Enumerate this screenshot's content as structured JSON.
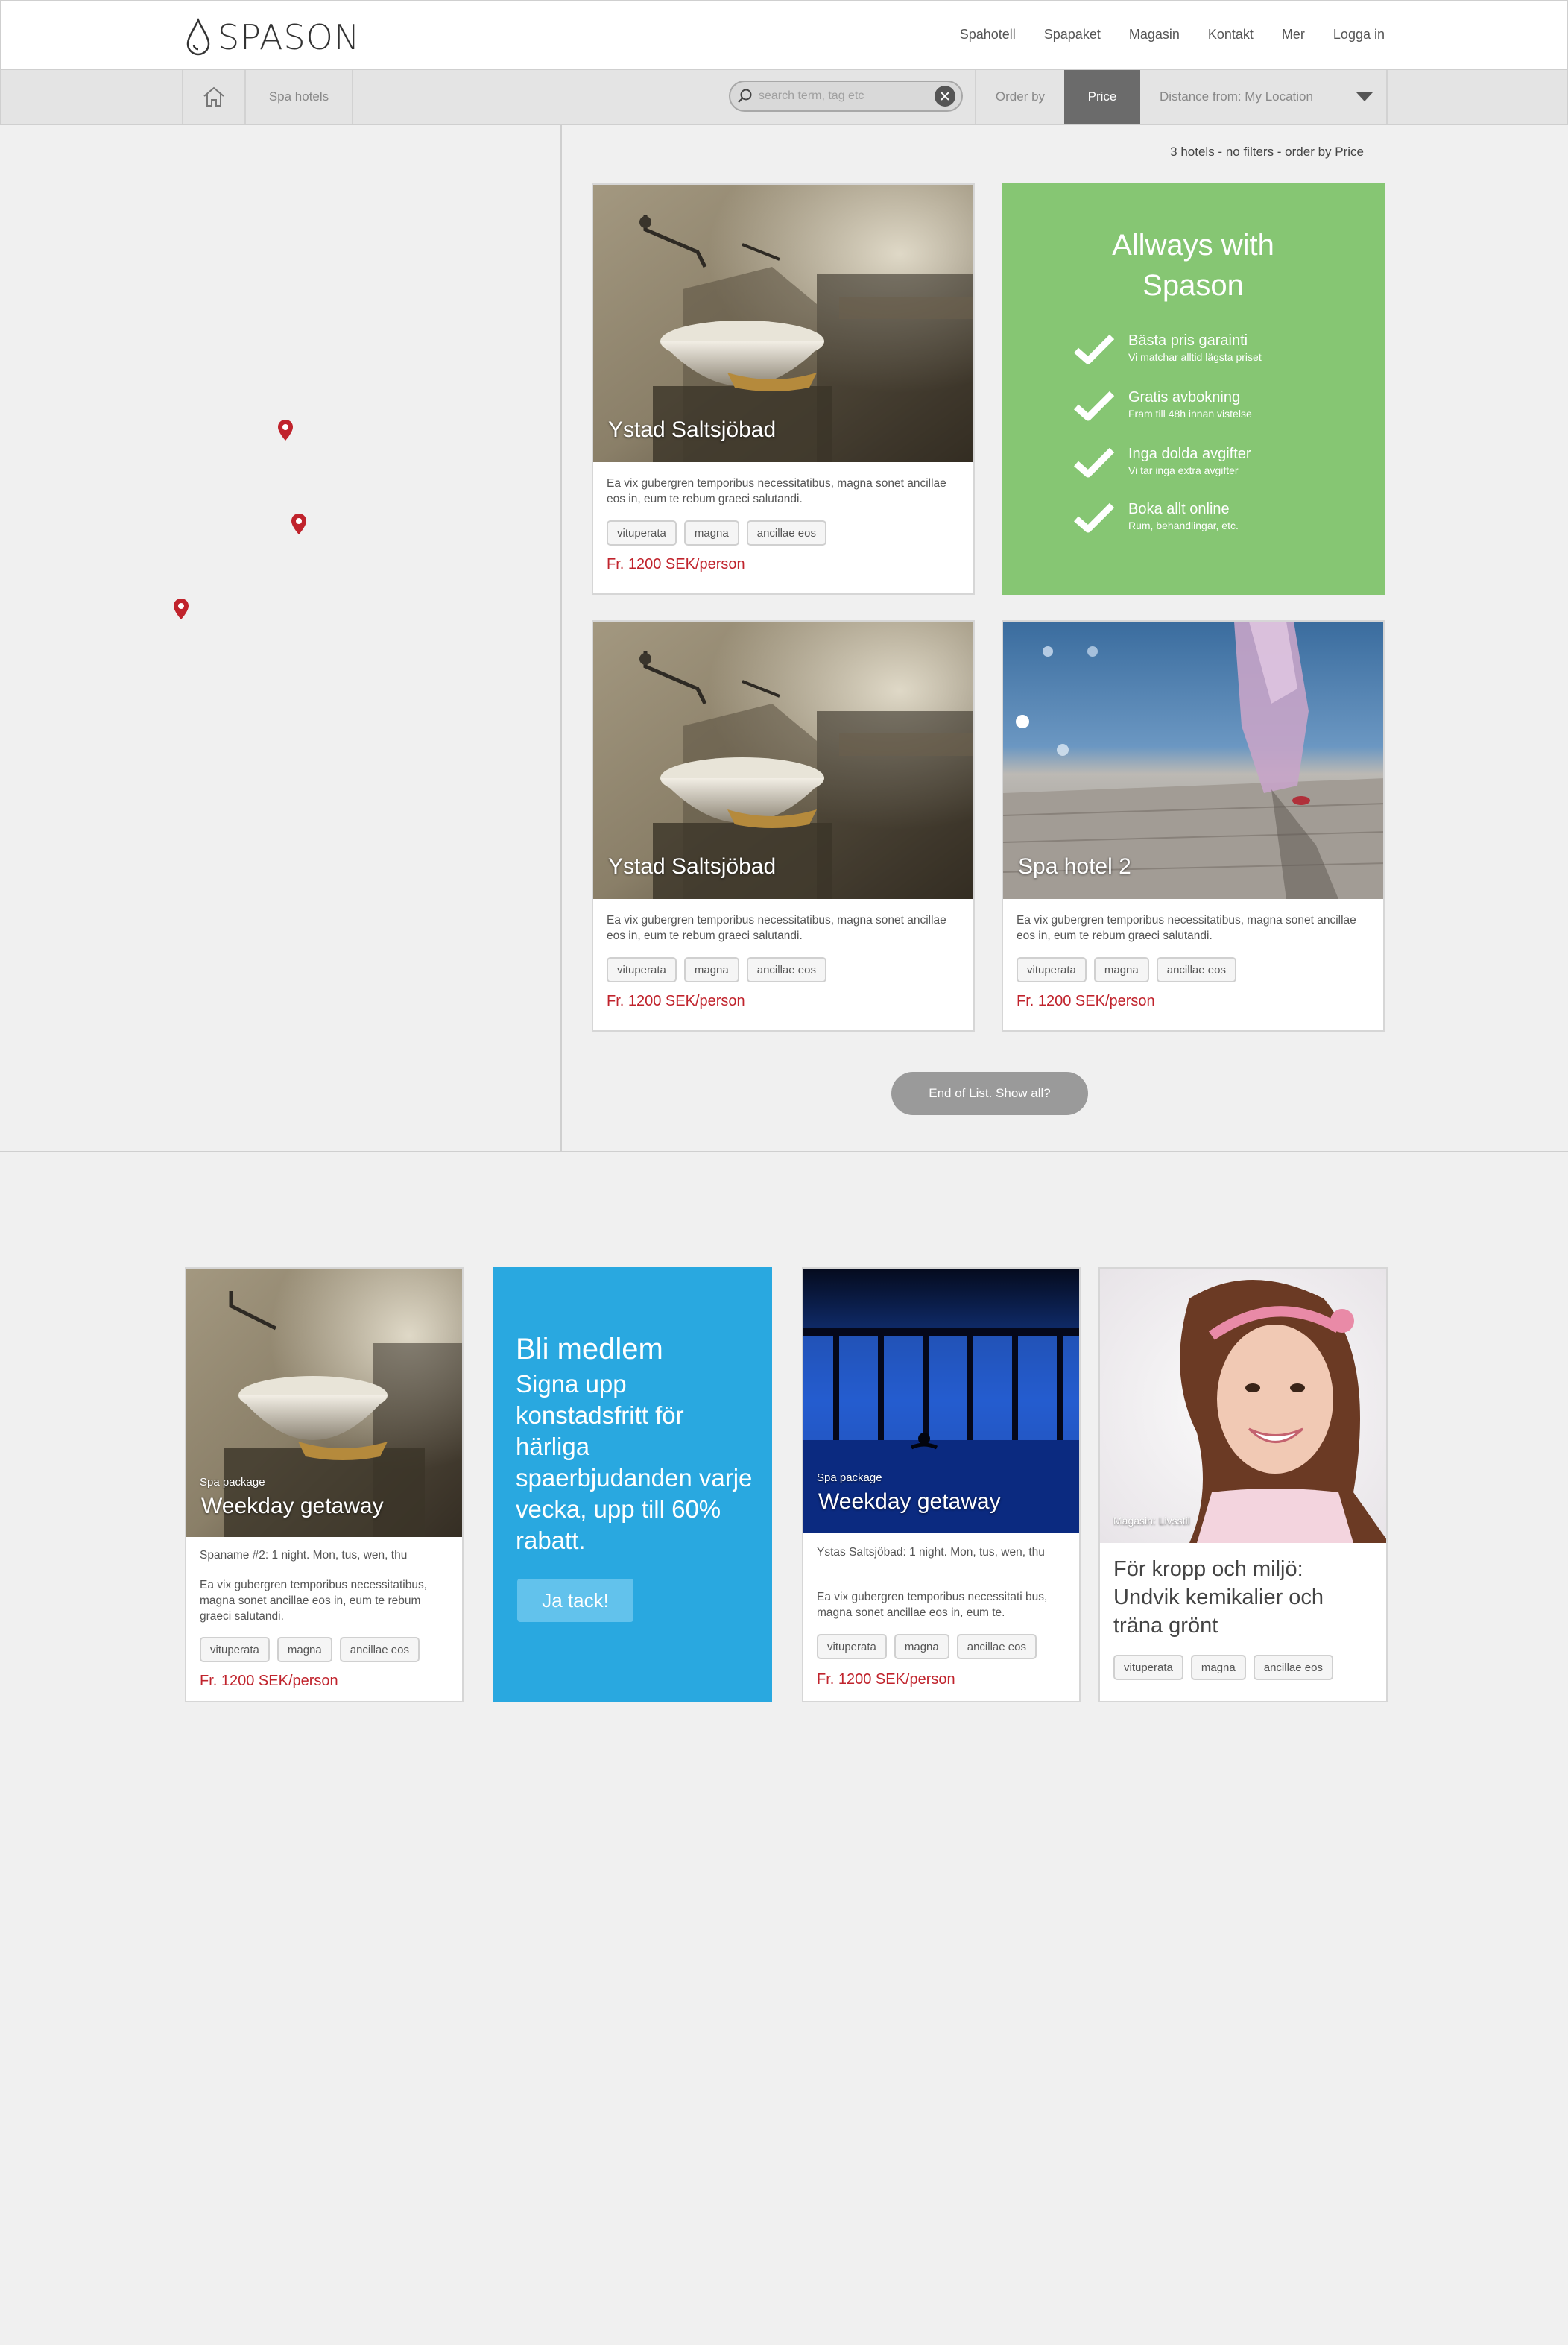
{
  "brand": {
    "name": "SPASON"
  },
  "nav": [
    "Spahotell",
    "Spapaket",
    "Magasin",
    "Kontakt",
    "Mer",
    "Logga in"
  ],
  "toolbar": {
    "home_icon": "home-icon",
    "breadcrumb": "Spa hotels",
    "search_placeholder": "search term, tag etc",
    "order_by": "Order by",
    "price": "Price",
    "distance": "Distance from: My Location"
  },
  "results_info": "3 hotels - no filters - order by Price",
  "hotels": [
    {
      "title": "Ystad Saltsjöbad",
      "desc": "Ea vix gubergren temporibus necessitatibus, magna sonet ancillae eos in, eum te rebum graeci salutandi.",
      "tags": [
        "vituperata",
        "magna",
        "ancillae eos"
      ],
      "price": "Fr. 1200 SEK/person"
    },
    {
      "title": "Ystad Saltsjöbad",
      "desc": "Ea vix gubergren temporibus necessitatibus, magna sonet ancillae eos in, eum te rebum graeci salutandi.",
      "tags": [
        "vituperata",
        "magna",
        "ancillae eos"
      ],
      "price": "Fr. 1200 SEK/person"
    },
    {
      "title": "Spa hotel 2",
      "desc": "Ea vix gubergren temporibus necessitatibus, magna sonet ancillae eos in, eum te rebum graeci salutandi.",
      "tags": [
        "vituperata",
        "magna",
        "ancillae eos"
      ],
      "price": "Fr. 1200 SEK/person"
    }
  ],
  "promo": {
    "title": "Allways with Spason",
    "benefits": [
      {
        "title": "Bästa pris garainti",
        "sub": "Vi matchar alltid lägsta priset"
      },
      {
        "title": "Gratis avbokning",
        "sub": "Fram till 48h innan vistelse"
      },
      {
        "title": "Inga dolda avgifter",
        "sub": "Vi tar inga extra avgifter"
      },
      {
        "title": "Boka allt online",
        "sub": "Rum, behandlingar, etc."
      }
    ]
  },
  "end_button": "End of List. Show all?",
  "bottom": {
    "package1": {
      "sub": "Spa package",
      "title": "Weekday getaway",
      "meta": "Spaname #2: 1 night. Mon, tus, wen, thu",
      "desc": "Ea vix gubergren temporibus necessitatibus, magna sonet ancillae eos in, eum te rebum graeci salutandi.",
      "tags": [
        "vituperata",
        "magna",
        "ancillae eos"
      ],
      "price": "Fr. 1200 SEK/person"
    },
    "member": {
      "title": "Bli medlem",
      "text": "Signa upp konstadsfritt för härliga spaerbjudanden varje vecka, upp till 60% rabatt.",
      "button": "Ja tack!"
    },
    "package2": {
      "sub": "Spa package",
      "title": "Weekday getaway",
      "meta": "Ystas Saltsjöbad: 1 night. Mon, tus, wen, thu",
      "desc": "Ea vix gubergren temporibus necessitati bus, magna sonet ancillae eos in, eum te.",
      "tags": [
        "vituperata",
        "magna",
        "ancillae eos"
      ],
      "price": "Fr. 1200 SEK/person"
    },
    "article": {
      "sub": "Magasin: Livsstil",
      "title": "För kropp och miljö: Undvik kemikalier och träna grönt",
      "tags": [
        "vituperata",
        "magna",
        "ancillae eos"
      ]
    }
  },
  "colors": {
    "price": "#c0232c",
    "green": "#86c673",
    "blue": "#29a8e0",
    "active_sort": "#6b6b6b"
  }
}
